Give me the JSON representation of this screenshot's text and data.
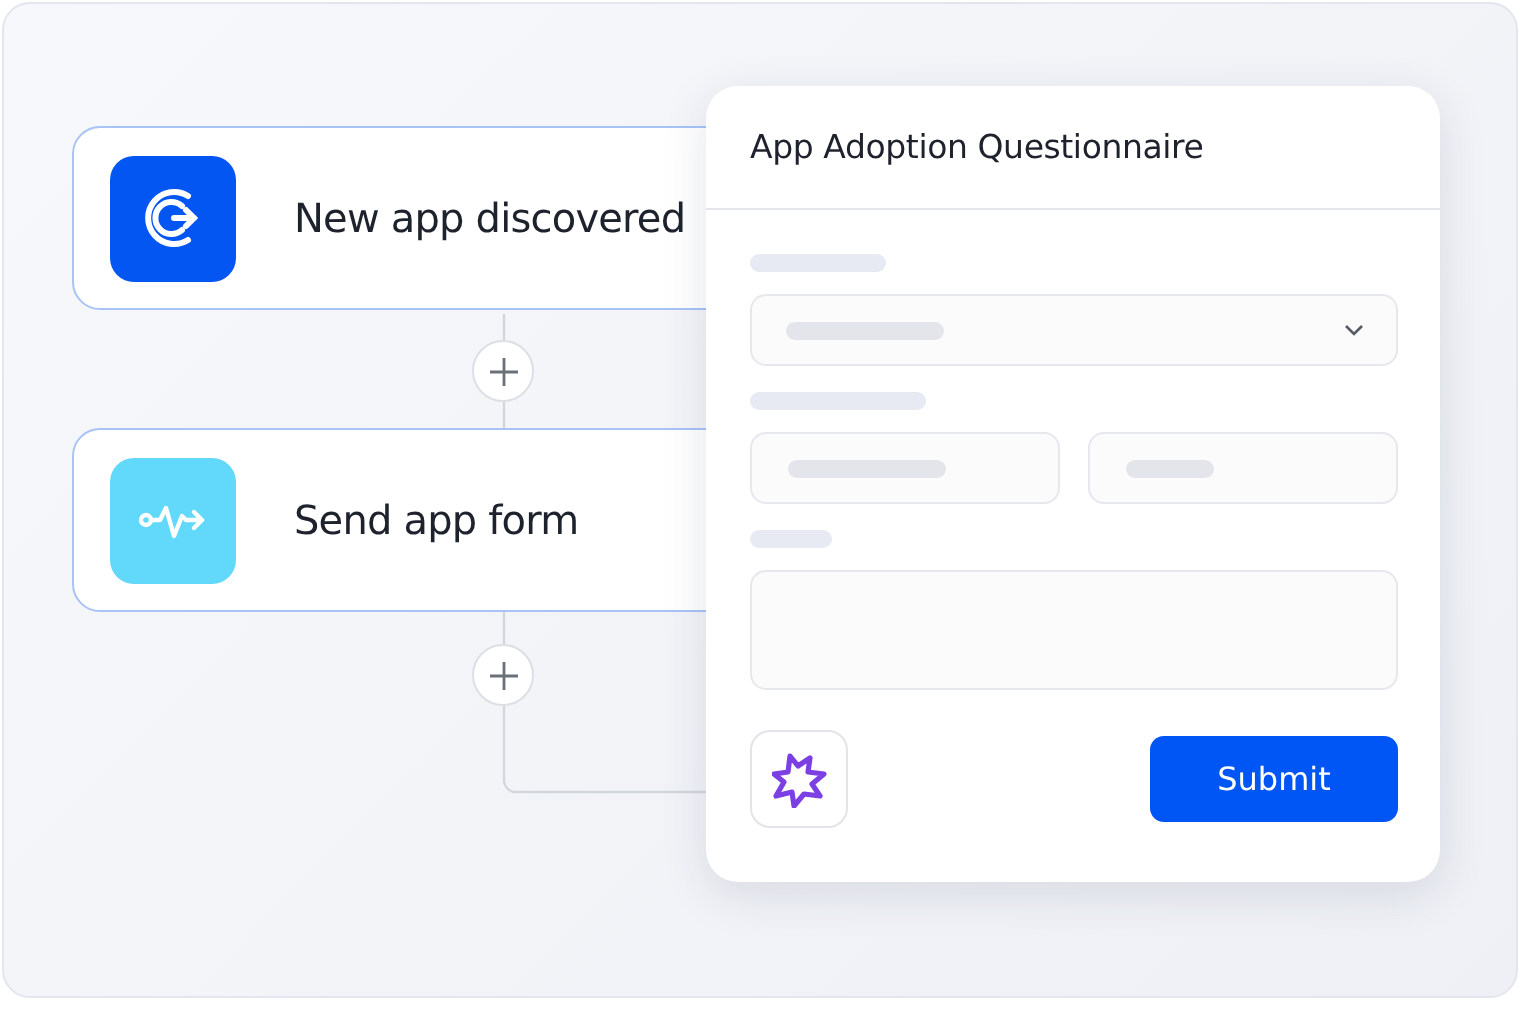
{
  "workflow": {
    "steps": [
      {
        "kind": "discover",
        "label": "New app discovered",
        "add_after": true
      },
      {
        "kind": "send",
        "label": "Send app form",
        "add_after": true
      }
    ]
  },
  "form": {
    "title": "App Adoption Questionnaire",
    "fields": [
      {
        "kind": "select"
      },
      {
        "kind": "pair"
      },
      {
        "kind": "textarea"
      }
    ],
    "submit": "Submit"
  }
}
